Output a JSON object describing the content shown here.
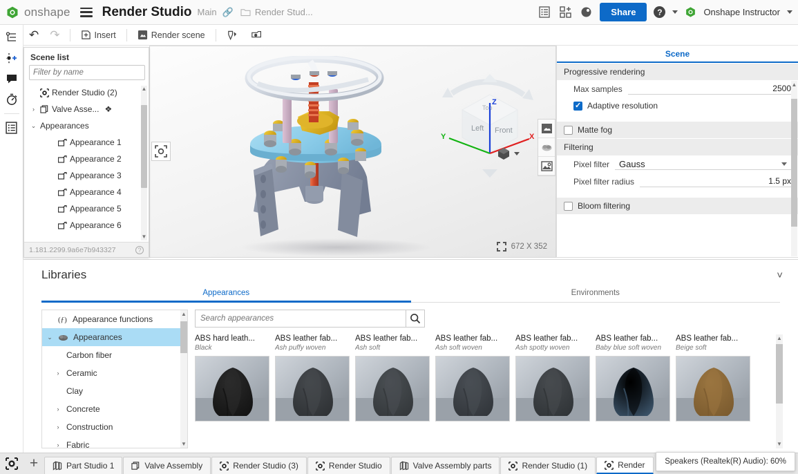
{
  "topbar": {
    "brand": "onshape",
    "doc_title": "Render Studio",
    "branch": "Main",
    "workspace": "Render Stud...",
    "share_label": "Share",
    "user": "Onshape Instructor",
    "icons": [
      "bom-icon",
      "app-store-icon",
      "learning-center-icon"
    ]
  },
  "toolbar": {
    "undo": "undo-icon",
    "redo": "redo-icon",
    "insert": "Insert",
    "render_scene": "Render scene",
    "appearance_tool": "appearance-picker-icon",
    "camera_tool": "camera-icon"
  },
  "rail": {
    "items": [
      "render-tree-icon",
      "add-light-icon",
      "comment-icon",
      "stopwatch-icon",
      "bom-icon"
    ]
  },
  "scene_list": {
    "title": "Scene list",
    "filter_placeholder": "Filter by name",
    "list_view_icon": "list-view-icon",
    "tree": [
      {
        "label": "Render Studio (2)",
        "depth": 0,
        "icon": "render-studio-icon",
        "twisty": ""
      },
      {
        "label": "Valve Asse...",
        "depth": 0,
        "icon": "assembly-icon",
        "twisty": "collapsed"
      },
      {
        "label": "Appearances",
        "depth": 0,
        "icon": "",
        "twisty": "expanded"
      },
      {
        "label": "Appearance 1",
        "depth": 1,
        "icon": "appearance-icon",
        "twisty": ""
      },
      {
        "label": "Appearance 2",
        "depth": 1,
        "icon": "appearance-icon",
        "twisty": ""
      },
      {
        "label": "Appearance 3",
        "depth": 1,
        "icon": "appearance-icon",
        "twisty": ""
      },
      {
        "label": "Appearance 4",
        "depth": 1,
        "icon": "appearance-icon",
        "twisty": ""
      },
      {
        "label": "Appearance 5",
        "depth": 1,
        "icon": "appearance-icon",
        "twisty": ""
      },
      {
        "label": "Appearance 6",
        "depth": 1,
        "icon": "appearance-icon",
        "twisty": ""
      }
    ],
    "version": "1.181.2299.9a6e7b943327"
  },
  "viewport": {
    "resolution": "672 X 352",
    "cube_faces": {
      "left": "Left",
      "front": "Front",
      "top": "Top"
    },
    "axes": {
      "x": "X",
      "y": "Y",
      "z": "Z"
    },
    "axis_colors": {
      "x": "#e02020",
      "y": "#12b312",
      "z": "#1a40d8"
    },
    "tools": [
      "render-preview-icon",
      "environment-icon",
      "image-settings-icon"
    ],
    "snap_icon": "fit-to-view-icon",
    "perspective_icon": "view-mode-cube-icon"
  },
  "scene_panel": {
    "tab": "Scene",
    "sections": [
      {
        "title": "Progressive rendering",
        "rows": [
          {
            "type": "value",
            "label": "Max samples",
            "value": "2500"
          },
          {
            "type": "check",
            "label": "Adaptive resolution",
            "checked": true
          }
        ]
      },
      {
        "type": "section-check",
        "title": "Matte fog",
        "checked": false
      },
      {
        "title": "Filtering",
        "rows": [
          {
            "type": "select",
            "label": "Pixel filter",
            "value": "Gauss"
          },
          {
            "type": "value",
            "label": "Pixel filter radius",
            "value": "1.5 px"
          }
        ]
      },
      {
        "type": "section-check",
        "title": "Bloom filtering",
        "checked": false
      }
    ]
  },
  "libraries": {
    "title": "Libraries",
    "collapse_icon": "chevron-down-icon",
    "tabs": [
      {
        "label": "Appearances",
        "active": true
      },
      {
        "label": "Environments",
        "active": false
      }
    ],
    "search_placeholder": "Search appearances",
    "search_icon": "search-icon",
    "categories": [
      {
        "label": "Appearance functions",
        "chev": "",
        "icon": "function-icon",
        "selected": false,
        "indent": 0
      },
      {
        "label": "Appearances",
        "chev": "expanded",
        "icon": "appearances-icon",
        "selected": true,
        "indent": 0
      },
      {
        "label": "Carbon fiber",
        "chev": "",
        "icon": "",
        "selected": false,
        "indent": 1
      },
      {
        "label": "Ceramic",
        "chev": "collapsed",
        "icon": "",
        "selected": false,
        "indent": 1
      },
      {
        "label": "Clay",
        "chev": "",
        "icon": "",
        "selected": false,
        "indent": 1
      },
      {
        "label": "Concrete",
        "chev": "collapsed",
        "icon": "",
        "selected": false,
        "indent": 1
      },
      {
        "label": "Construction",
        "chev": "collapsed",
        "icon": "",
        "selected": false,
        "indent": 1
      },
      {
        "label": "Fabric",
        "chev": "collapsed",
        "icon": "",
        "selected": false,
        "indent": 1
      }
    ],
    "cards": [
      {
        "title": "ABS hard leath...",
        "subtitle": "Black",
        "color": "#121212",
        "shade": "#2b2b2b"
      },
      {
        "title": "ABS leather fab...",
        "subtitle": "Ash puffy woven",
        "color": "#2e3134",
        "shade": "#45494d"
      },
      {
        "title": "ABS leather fab...",
        "subtitle": "Ash soft",
        "color": "#33373a",
        "shade": "#4a4f53"
      },
      {
        "title": "ABS leather fab...",
        "subtitle": "Ash soft woven",
        "color": "#31353a",
        "shade": "#494e54"
      },
      {
        "title": "ABS leather fab...",
        "subtitle": "Ash spotty woven",
        "color": "#2f3336",
        "shade": "#474b4f"
      },
      {
        "title": "ABS leather fab...",
        "subtitle": "Baby blue soft woven",
        "color": "#3d566d",
        "shade": "#567characters"
      },
      {
        "title": "ABS leather fab...",
        "subtitle": "Beige soft",
        "color": "#7a5a2e",
        "shade": "#9a7540"
      }
    ]
  },
  "tabbar": {
    "studio_icon": "render-studio-icon",
    "add_label": "+",
    "tabs": [
      {
        "label": "Part Studio 1",
        "icon": "part-studio-icon",
        "active": false
      },
      {
        "label": "Valve Assembly",
        "icon": "assembly-icon",
        "active": false
      },
      {
        "label": "Render Studio (3)",
        "icon": "render-studio-icon",
        "active": false
      },
      {
        "label": "Render Studio",
        "icon": "render-studio-icon",
        "active": false
      },
      {
        "label": "Valve Assembly parts",
        "icon": "part-studio-icon",
        "active": false
      },
      {
        "label": "Render Studio (1)",
        "icon": "render-studio-icon",
        "active": false
      },
      {
        "label": "Render",
        "icon": "render-studio-icon",
        "active": true
      }
    ]
  },
  "toast": {
    "text": "Speakers (Realtek(R) Audio): 60%"
  },
  "colors": {
    "accent": "#0d6ac8",
    "selection": "#aadcf5",
    "panel": "#ececec"
  }
}
